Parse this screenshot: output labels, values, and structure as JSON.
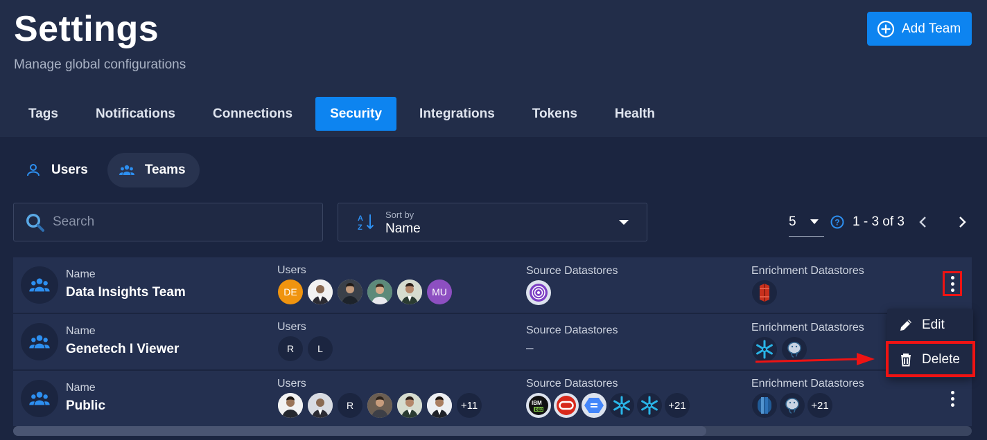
{
  "header": {
    "title": "Settings",
    "subtitle": "Manage global configurations",
    "add_button_label": "Add Team"
  },
  "tabs": [
    {
      "label": "Tags",
      "active": false
    },
    {
      "label": "Notifications",
      "active": false
    },
    {
      "label": "Connections",
      "active": false
    },
    {
      "label": "Security",
      "active": true
    },
    {
      "label": "Integrations",
      "active": false
    },
    {
      "label": "Tokens",
      "active": false
    },
    {
      "label": "Health",
      "active": false
    }
  ],
  "subtabs": [
    {
      "label": "Users",
      "icon": "user-icon",
      "active": false
    },
    {
      "label": "Teams",
      "icon": "team-icon",
      "active": true
    }
  ],
  "search": {
    "placeholder": "Search",
    "value": ""
  },
  "sort": {
    "label": "Sort by",
    "value": "Name"
  },
  "pagination": {
    "per_page": "5",
    "range": "1 - 3 of 3"
  },
  "columns": {
    "name": "Name",
    "users": "Users",
    "source": "Source Datastores",
    "enrichment": "Enrichment Datastores"
  },
  "rows": [
    {
      "name": "Data Insights Team",
      "users": [
        "DE",
        "photo",
        "photo",
        "photo",
        "photo",
        "MU"
      ],
      "source": [
        "fingerprint-datastore-icon"
      ],
      "source_empty": "",
      "enrichment": [
        "aws-s3-icon"
      ]
    },
    {
      "name": "Genetech I Viewer",
      "users": [
        "R",
        "L"
      ],
      "source": [],
      "source_empty": "–",
      "enrichment": [
        "snowflake-icon",
        "postgresql-icon"
      ]
    },
    {
      "name": "Public",
      "users": [
        "photo",
        "photo",
        "R",
        "photo",
        "photo",
        "photo"
      ],
      "users_more": "+11",
      "source": [
        "ibm-db2-icon",
        "oracle-icon",
        "bigquery-icon",
        "snowflake-icon",
        "snowflake-icon"
      ],
      "source_more": "+21",
      "enrichment": [
        "redshift-icon",
        "postgresql-icon"
      ],
      "enrichment_more": "+21"
    }
  ],
  "row_menu": {
    "edit_label": "Edit",
    "delete_label": "Delete"
  },
  "colors": {
    "background": "#1b2540",
    "header": "#222d49",
    "accent": "#0d84f0",
    "row": "#243050",
    "highlight": "#ee1313"
  }
}
